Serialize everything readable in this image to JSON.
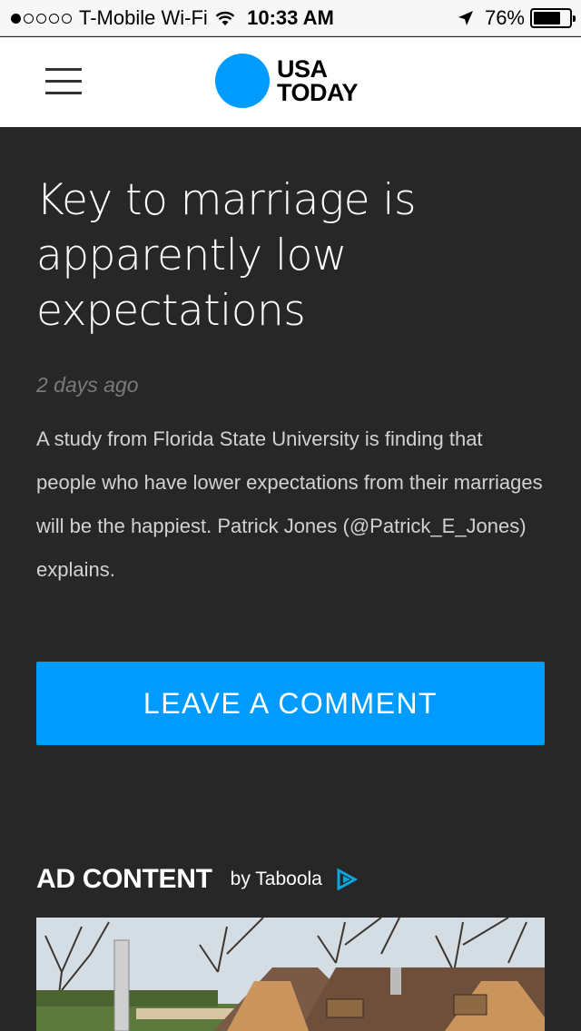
{
  "status_bar": {
    "carrier": "T-Mobile Wi-Fi",
    "time": "10:33 AM",
    "battery": "76%",
    "battery_level": 0.76,
    "signal_dots_filled": 1
  },
  "header": {
    "logo_line1": "USA",
    "logo_line2": "TODAY",
    "brand_color": "#009bff"
  },
  "article": {
    "headline": "Key to marriage is apparently low expectations",
    "timestamp": "2 days ago",
    "summary": "A study from Florida State University is finding that people who have lower expectations from their marriages will be the happiest. Patrick Jones (@Patrick_E_Jones) explains."
  },
  "comment_button": {
    "label": "LEAVE A COMMENT"
  },
  "ad_section": {
    "title": "AD CONTENT",
    "by": "by Taboola"
  },
  "colors": {
    "background": "#272727",
    "accent": "#009bff"
  }
}
